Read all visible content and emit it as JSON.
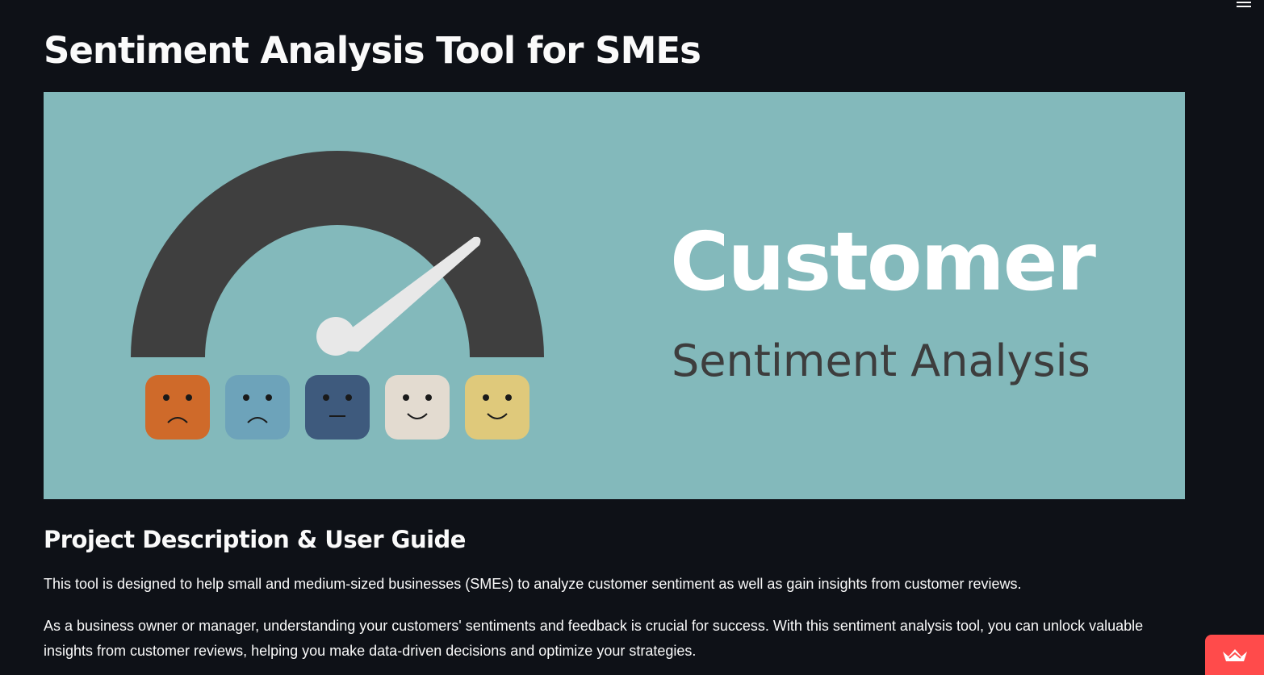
{
  "app": {
    "title": "Sentiment Analysis Tool for SMEs"
  },
  "banner": {
    "title": "Customer",
    "subtitle": "Sentiment Analysis",
    "background": "#83b9bb",
    "faces": [
      "very-sad",
      "sad",
      "neutral",
      "happy",
      "very-happy"
    ],
    "face_colors": [
      "#cf6a2a",
      "#6da3ba",
      "#3e5a7d",
      "#e3dbd0",
      "#dfc97b"
    ]
  },
  "section": {
    "heading": "Project Description & User Guide",
    "paragraphs": [
      "This tool is designed to help small and medium-sized businesses (SMEs) to analyze customer sentiment as well as gain insights from customer reviews.",
      "As a business owner or manager, understanding your customers' sentiments and feedback is crucial for success. With this sentiment analysis tool, you can unlock valuable insights from customer reviews, helping you make data-driven decisions and optimize your strategies."
    ]
  },
  "icons": {
    "menu": "hamburger-menu-icon",
    "badge": "streamlit-crown-icon"
  },
  "colors": {
    "background": "#0e1117",
    "text": "#fafafa",
    "accent": "#ff4b4b"
  }
}
